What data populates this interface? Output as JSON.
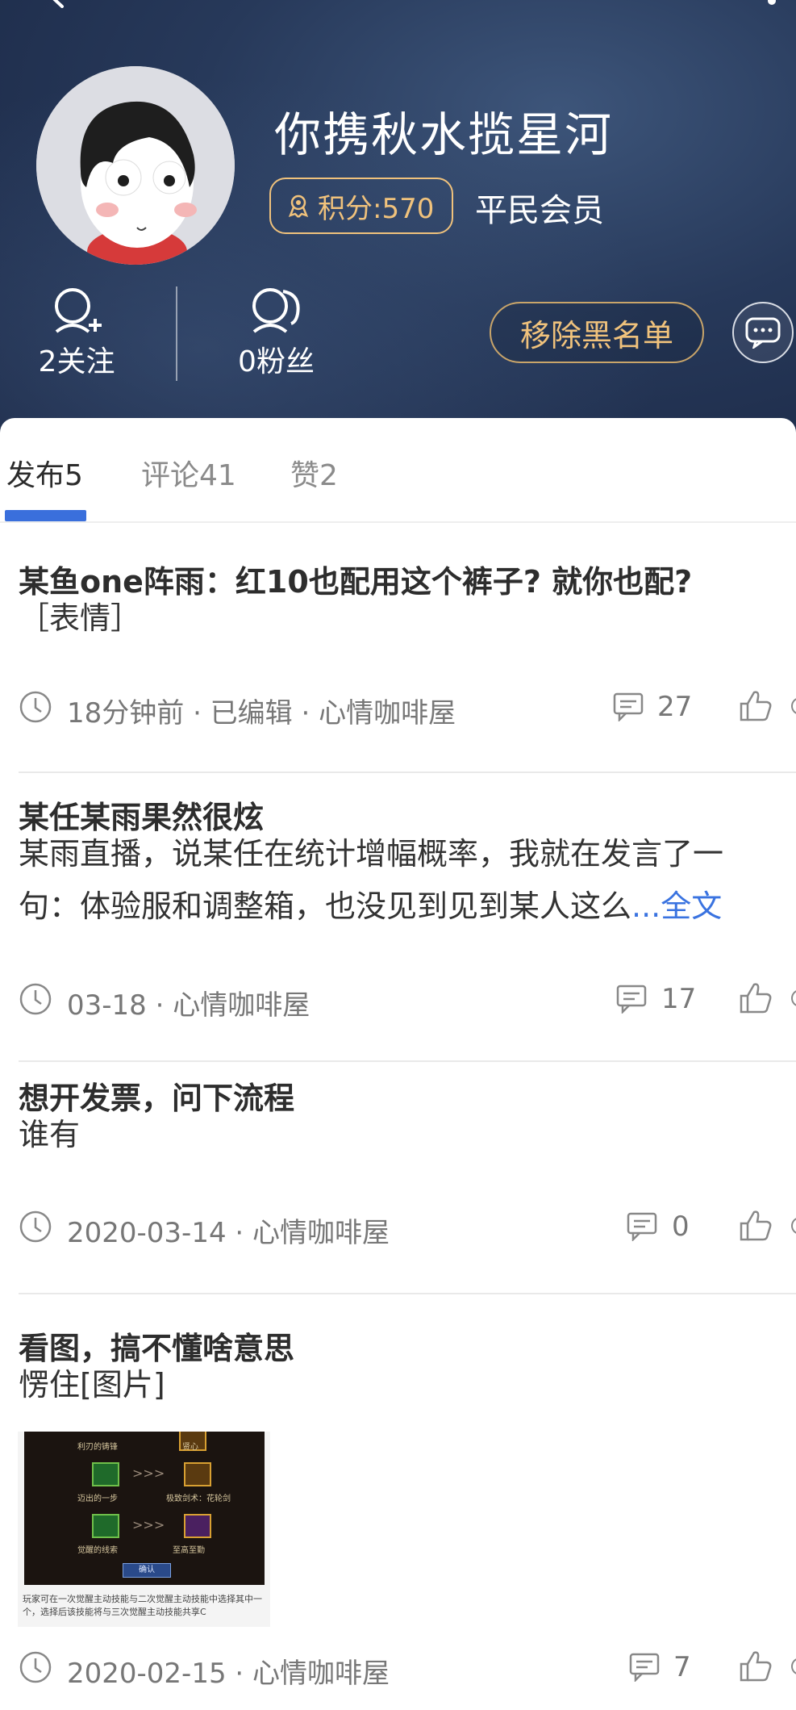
{
  "profile": {
    "username": "你携秋水揽星河",
    "points_label": "积分:570",
    "member_level": "平民会员",
    "follow_label": "2关注",
    "fans_label": "0粉丝",
    "unblock_label": "移除黑名单"
  },
  "tabs": [
    {
      "label": "发布5",
      "active": true
    },
    {
      "label": "评论41",
      "active": false
    },
    {
      "label": "赞2",
      "active": false
    }
  ],
  "posts": [
    {
      "title": "某鱼one阵雨：红10也配用这个裤子? 就你也配?",
      "body_lines": [
        "［表情］"
      ],
      "meta": "18分钟前 · 已编辑  ·  心情咖啡屋",
      "comments": "27"
    },
    {
      "title": "某任某雨果然很炫",
      "body_lines": [
        "某雨直播，说某任在统计增幅概率，我就在发言了一",
        "句：体验服和调整箱，也没见到见到某人这么"
      ],
      "more_label": "...全文",
      "meta": "03-18  ·  心情咖啡屋",
      "comments": "17"
    },
    {
      "title": "想开发票，问下流程",
      "body_lines": [
        "谁有"
      ],
      "meta": "2020-03-14  ·  心情咖啡屋",
      "comments": "0"
    },
    {
      "title": "看图，搞不懂啥意思",
      "body_lines": [
        "愣住[图片]"
      ],
      "image": {
        "labels": [
          "利刃的铸锋",
          "贤心",
          "迈出的一步",
          "极致剑术：花轮剑",
          "觉醒的线索",
          "至高至勤"
        ],
        "confirm_label": "确认",
        "caption": "玩家可在一次觉醒主动技能与二次觉醒主动技能中选择其中一个，选择后该技能将与三次觉醒主动技能共享C"
      },
      "meta": "2020-02-15  ·  心情咖啡屋",
      "comments": "7"
    }
  ],
  "colors": {
    "accent_blue": "#3a6fdc",
    "gold": "#f0c27c",
    "header_bg": "#27395a"
  }
}
